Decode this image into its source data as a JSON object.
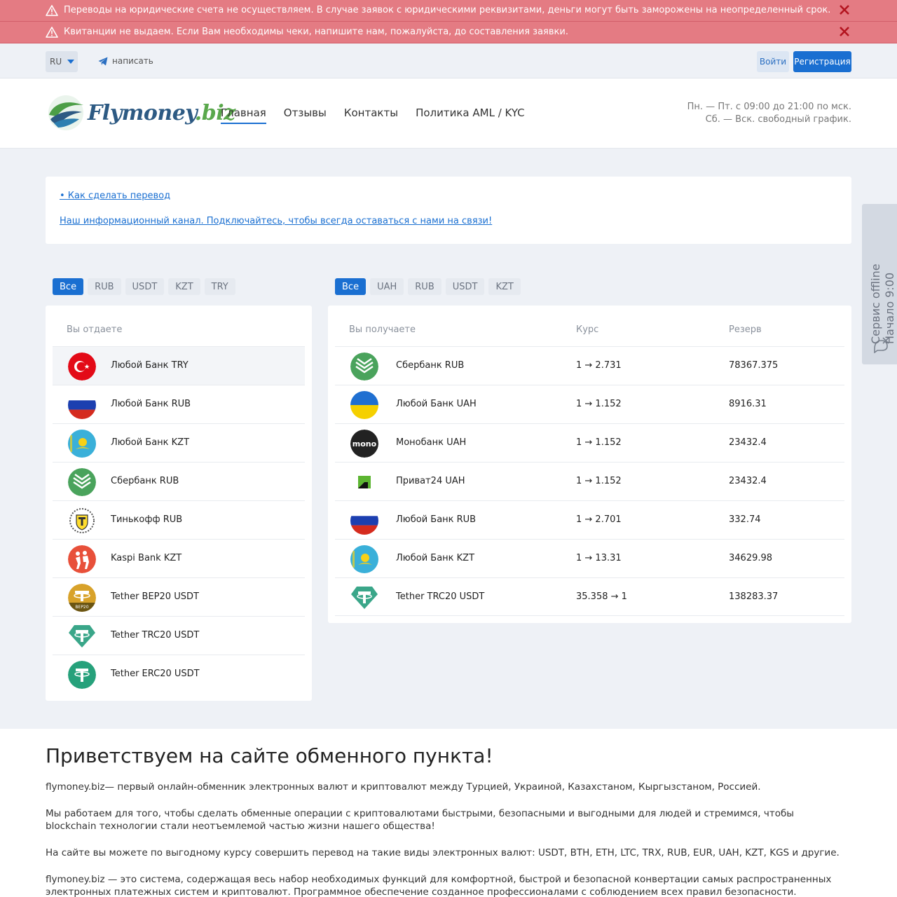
{
  "alerts": [
    {
      "text": "Переводы на юридические счета не осуществляем. В случае заявок с юридическими реквизитами, деньги могут быть заморожены на неопределенный срок."
    },
    {
      "text": "Квитанции не выдаем. Если Вам необходимы чеки, напишите нам, пожалуйста, до составления заявки."
    }
  ],
  "topbar": {
    "lang": "RU",
    "write": "написать",
    "login": "Войти",
    "register": "Регистрация"
  },
  "header": {
    "logo_main": "Flymoney",
    "logo_suffix": ".biz",
    "nav": [
      "Главная",
      "Отзывы",
      "Контакты",
      "Политика AML / KYC"
    ],
    "hours_1": "Пн. — Пт. с 09:00 до 21:00 по мск.",
    "hours_2": "Сб. — Вск. свободный график."
  },
  "info": {
    "link_1": "• Как сделать перевод",
    "link_2": "Наш информационный канал. Подключайтесь, чтобы всегда оставаться с нами на связи!"
  },
  "give": {
    "filters": [
      "Все",
      "RUB",
      "USDT",
      "KZT",
      "TRY"
    ],
    "header": "Вы отдаете",
    "items": [
      {
        "name": "Любой Банк TRY",
        "icon": "turkey-flag-icon"
      },
      {
        "name": "Любой Банк RUB",
        "icon": "russia-flag-icon"
      },
      {
        "name": "Любой Банк KZT",
        "icon": "kazakhstan-flag-icon"
      },
      {
        "name": "Сбербанк RUB",
        "icon": "sberbank-icon"
      },
      {
        "name": "Тинькофф RUB",
        "icon": "tinkoff-icon"
      },
      {
        "name": "Kaspi Bank KZT",
        "icon": "kaspi-icon"
      },
      {
        "name": "Tether BEP20 USDT",
        "icon": "tether-bep20-icon"
      },
      {
        "name": "Tether TRC20 USDT",
        "icon": "tether-trc20-icon"
      },
      {
        "name": "Tether ERC20 USDT",
        "icon": "tether-erc20-icon"
      }
    ]
  },
  "get": {
    "filters": [
      "Все",
      "UAH",
      "RUB",
      "USDT",
      "KZT"
    ],
    "header_name": "Вы получаете",
    "header_rate": "Курс",
    "header_reserve": "Резерв",
    "items": [
      {
        "name": "Сбербанк RUB",
        "rate": "1 → 2.731",
        "reserve": "78367.375",
        "icon": "sberbank-icon"
      },
      {
        "name": "Любой Банк UAH",
        "rate": "1 → 1.152",
        "reserve": "8916.31",
        "icon": "ukraine-flag-icon"
      },
      {
        "name": "Монобанк UAH",
        "rate": "1 → 1.152",
        "reserve": "23432.4",
        "icon": "monobank-icon"
      },
      {
        "name": "Приват24 UAH",
        "rate": "1 → 1.152",
        "reserve": "23432.4",
        "icon": "privat24-icon"
      },
      {
        "name": "Любой Банк RUB",
        "rate": "1 → 2.701",
        "reserve": "332.74",
        "icon": "russia-flag-icon"
      },
      {
        "name": "Любой Банк KZT",
        "rate": "1 → 13.31",
        "reserve": "34629.98",
        "icon": "kazakhstan-flag-icon"
      },
      {
        "name": "Tether TRC20 USDT",
        "rate": "35.358 → 1",
        "reserve": "138283.37",
        "icon": "tether-trc20-icon"
      }
    ]
  },
  "welcome": {
    "title": "Приветствуем на сайте обменного пункта!",
    "p1": "flymoney.biz— первый онлайн-обменник электронных валют и криптовалют между Турцией, Украиной, Казахстаном, Кыргызстаном, Россией.",
    "p2": "Мы работаем для того, чтобы сделать обменные операции с криптовалютами быстрыми, безопасными и выгодными для людей и стремимся, чтобы blockchain технологии стали неотъемлемой частью жизни нашего общества!",
    "p3": "На сайте вы можете по выгодному курсу совершить перевод на такие виды электронных валют: USDT, BTH, ETH, LTC, TRX, RUB, EUR, UAH, KZT, KGS и другие.",
    "p4": "flymoney.biz — это система, содержащая весь набор необходимых функций для комфортной, быстрой и безопасной конвертации самых распространенных электронных платежных систем и криптовалют. Программное обеспечение созданное профессионалами с соблюдением всех правил безопасности."
  },
  "offline": {
    "line1": "Сервис offline",
    "line2": "Начало 9:00"
  },
  "colors": {
    "accent": "#1a6fd1",
    "alert": "#e47b83",
    "bg": "#eef1f6"
  }
}
